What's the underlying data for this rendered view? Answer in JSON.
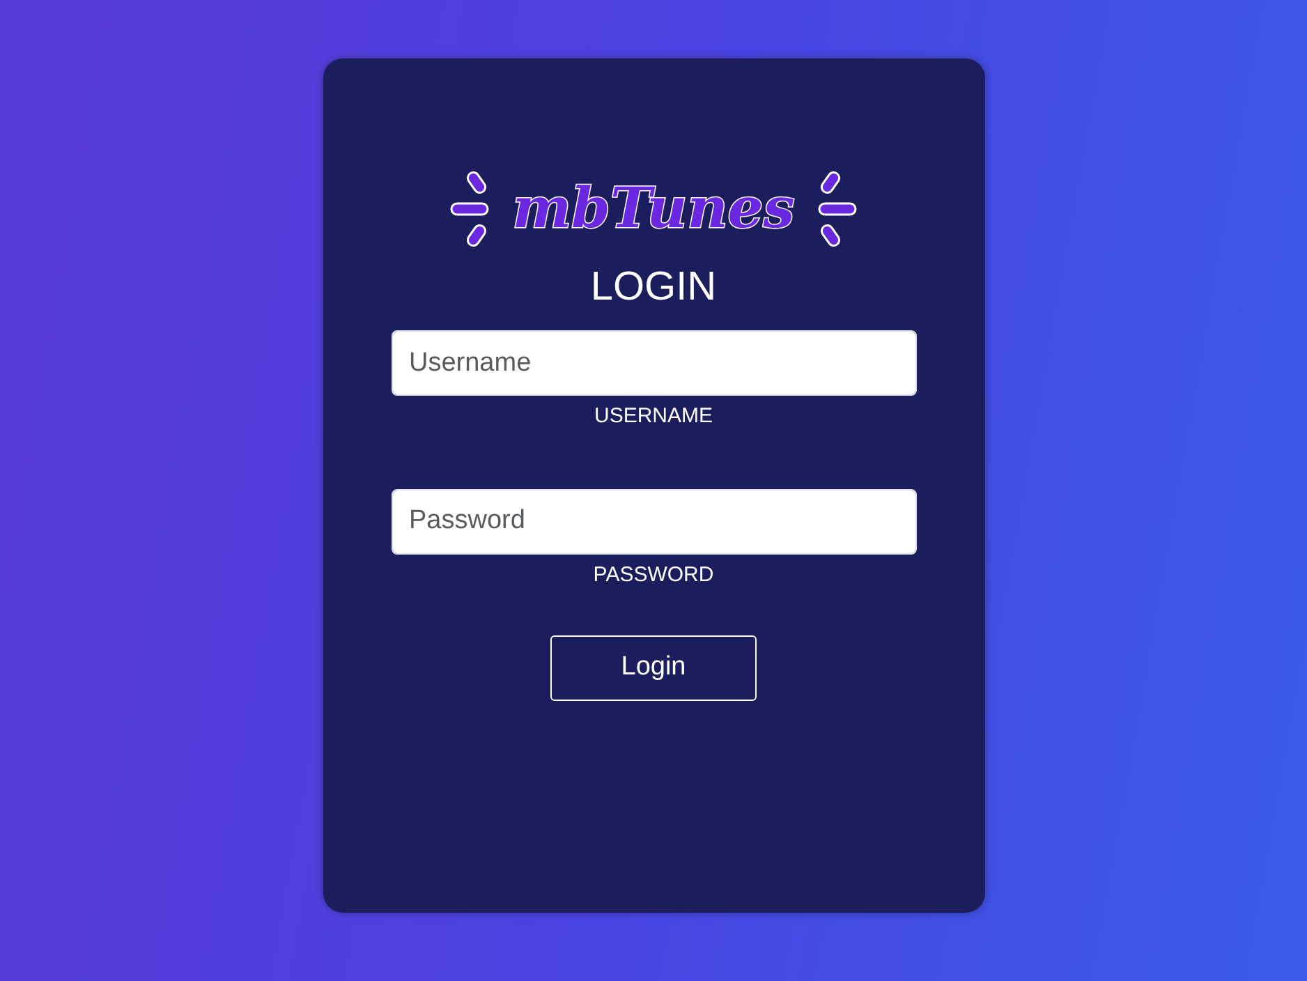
{
  "logo": {
    "text": "mbTunes"
  },
  "title": "LOGIN",
  "fields": [
    {
      "placeholder": "Username",
      "label": "USERNAME"
    },
    {
      "placeholder": "Password",
      "label": "PASSWORD"
    }
  ],
  "button": "Login"
}
